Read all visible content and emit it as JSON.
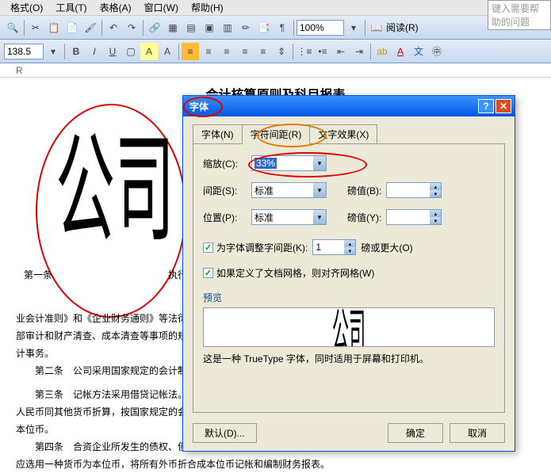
{
  "menu": {
    "format": "格式(O)",
    "tools": "工具(T)",
    "table": "表格(A)",
    "window": "窗口(W)",
    "help": "帮助(H)"
  },
  "helpPlaceholder": "键入需要帮助的问题",
  "zoom": "100%",
  "readMode": "阅读(R)",
  "fontsize": "138.5",
  "ruler": "R",
  "doc": {
    "title": "会计核算原则及科目报表",
    "bigchar": "公司",
    "line1_prefix": "第一条",
    "line1_suffix": "执行《",
    "body1": "业会计准则》和《企业财务通则》等法律",
    "body2": "部审计和财产清查、成本清查等事项的规",
    "body3": "计事务。",
    "body4": "　　第二条　公司采用国家规定的会计制",
    "body5": "　　第三条　记帐方法采用借贷记帐法。",
    "body6": "人民币同其他货币折算，按国家规定的会",
    "body7": "本位币。",
    "body8": "　　第四条　合资企业所发生的债权、债务、权益和费用等应按实际权利的货币记帐，同时",
    "body9": "应选用一种货币为本位币，将所有外币折合成本位币记帐和编制财务报表。"
  },
  "dlg": {
    "title": "字体",
    "tabs": {
      "font": "字体(N)",
      "spacing": "字符间距(R)",
      "effects": "文字效果(X)"
    },
    "scale_lbl": "缩放(C):",
    "scale_val": "33%",
    "spacing_lbl": "间距(S):",
    "spacing_val": "标准",
    "pt1_lbl": "磅值(B):",
    "position_lbl": "位置(P):",
    "position_val": "标准",
    "pt2_lbl": "磅值(Y):",
    "kern_chk": "为字体调整字间距(K):",
    "kern_val": "1",
    "kern_unit": "磅或更大(O)",
    "grid_chk": "如果定义了文档网格，则对齐网格(W)",
    "preview_lbl": "预览",
    "preview_text": "公司",
    "desc": "这是一种 TrueType 字体，同时适用于屏幕和打印机。",
    "default_btn": "默认(D)...",
    "ok": "确定",
    "cancel": "取消"
  },
  "chart_data": null
}
